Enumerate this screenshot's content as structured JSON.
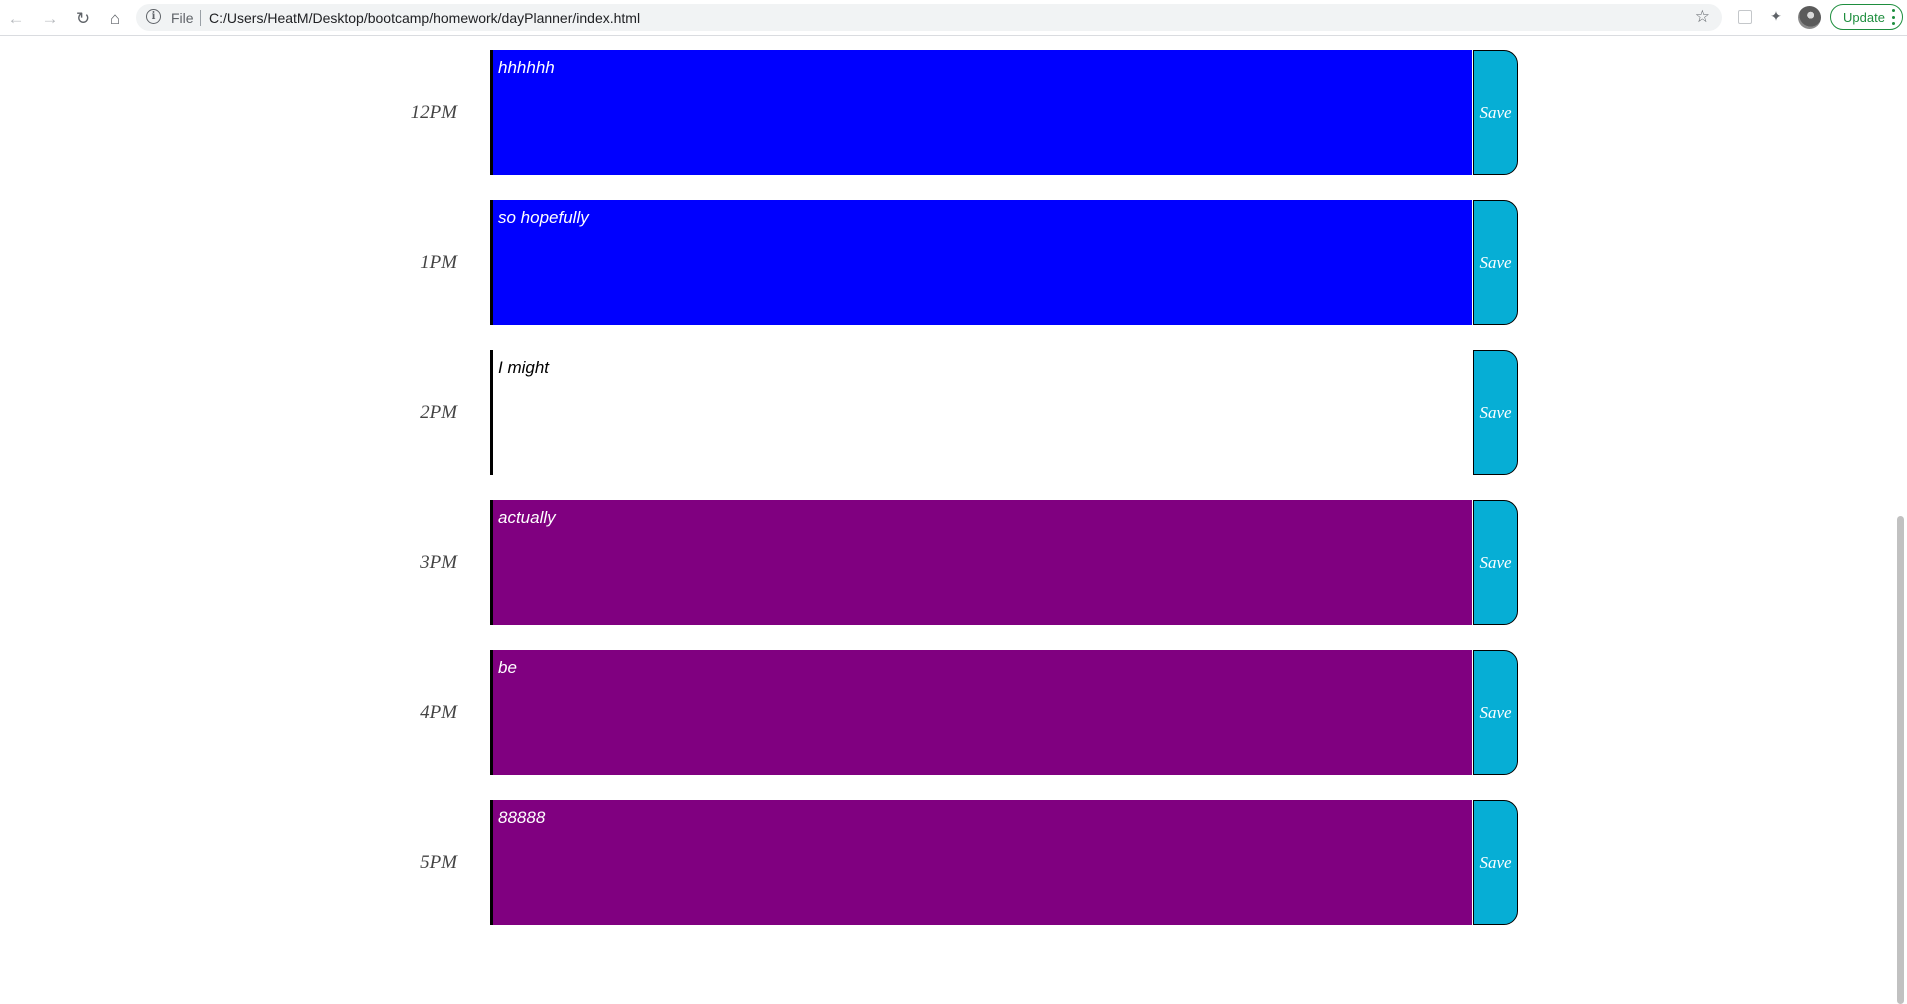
{
  "browser": {
    "scheme_label": "File",
    "url": "C:/Users/HeatM/Desktop/bootcamp/homework/dayPlanner/index.html",
    "update_label": "Update"
  },
  "planner": {
    "rows": [
      {
        "hour": "12PM",
        "text": "hhhhhh",
        "state": "present",
        "save_label": "Save"
      },
      {
        "hour": "1PM",
        "text": "so hopefully",
        "state": "present",
        "save_label": "Save"
      },
      {
        "hour": "2PM",
        "text": "I might",
        "state": "past",
        "save_label": "Save"
      },
      {
        "hour": "3PM",
        "text": "actually",
        "state": "future",
        "save_label": "Save"
      },
      {
        "hour": "4PM",
        "text": "be",
        "state": "future",
        "save_label": "Save"
      },
      {
        "hour": "5PM",
        "text": "88888",
        "state": "future",
        "save_label": "Save"
      }
    ]
  },
  "colors": {
    "present_block": "#0000ff",
    "past_block": "#ffffff",
    "future_block": "#800080",
    "save_button": "#06aed5",
    "update_green": "#1e8e3e"
  },
  "icons": [
    "back-arrow-icon",
    "forward-arrow-icon",
    "reload-icon",
    "home-icon",
    "info-icon",
    "bookmark-star-icon",
    "extension-icon",
    "puzzle-icon",
    "avatar",
    "menu-dots-icon"
  ]
}
